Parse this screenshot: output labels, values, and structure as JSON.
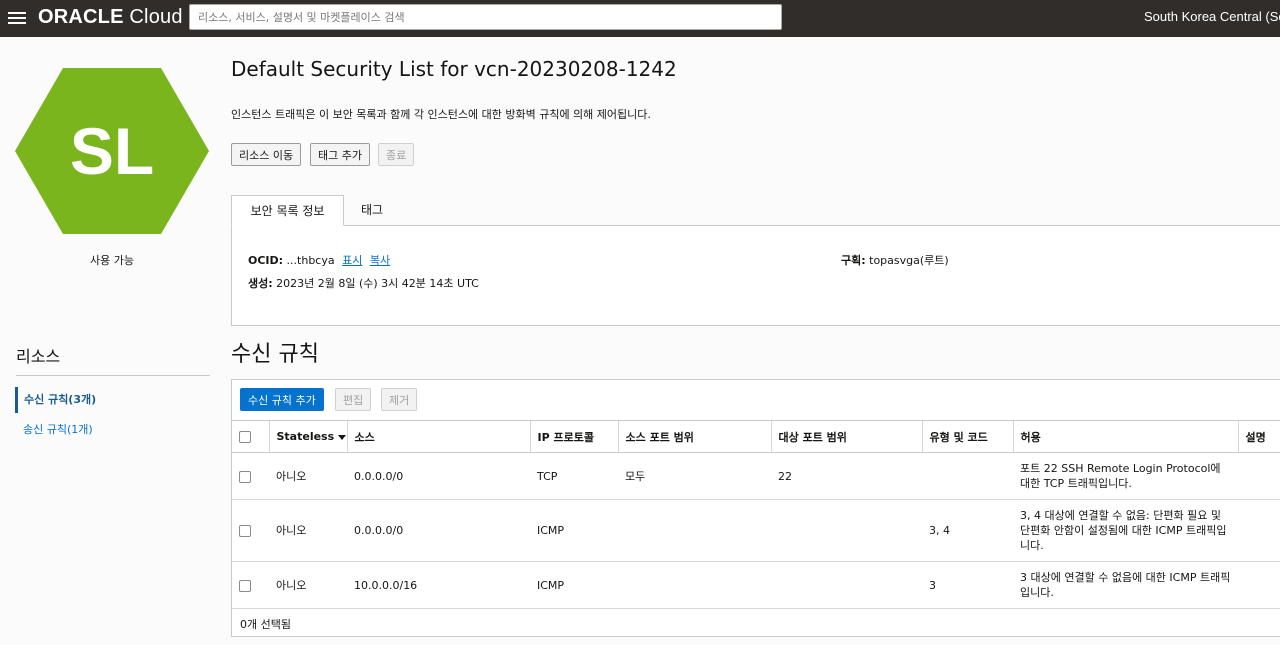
{
  "topbar": {
    "brand_bold": "ORACLE",
    "brand_light": " Cloud",
    "search_placeholder": "리소스, 서비스, 설명서 및 마켓플레이스 검색",
    "region": "South Korea Central (Seoul)"
  },
  "resource": {
    "badge_text": "SL",
    "badge_color": "#7ab51d",
    "status": "사용 가능"
  },
  "header": {
    "title": "Default Security List for vcn-20230208-1242",
    "description": "인스턴스 트래픽은 이 보안 목록과 함께 각 인스턴스에 대한 방화벽 규칙에 의해 제어됩니다.",
    "buttons": {
      "move": "리소스 이동",
      "add_tag": "태그 추가",
      "terminate": "종료"
    }
  },
  "tabs": {
    "info": "보안 목록 정보",
    "tags": "태그"
  },
  "info": {
    "ocid_label": "OCID:",
    "ocid_value": "...thbcya",
    "show_link": "표시",
    "copy_link": "복사",
    "created_label": "생성:",
    "created_value": "2023년 2월 8일 (수) 3시 42분 14초 UTC",
    "compartment_label": "구획:",
    "compartment_value": "topasvga(루트)"
  },
  "sidebar": {
    "title": "리소스",
    "items": [
      {
        "label": "수신 규칙(3개)"
      },
      {
        "label": "송신 규칙(1개)"
      }
    ]
  },
  "ingress": {
    "section_title": "수신 규칙",
    "buttons": {
      "add": "수신 규칙 추가",
      "edit": "편집",
      "remove": "제거"
    },
    "columns": [
      "Stateless",
      "소스",
      "IP 프로토콜",
      "소스 포트 범위",
      "대상 포트 범위",
      "유형 및 코드",
      "허용",
      "설명"
    ],
    "rows": [
      {
        "stateless": "아니오",
        "source": "0.0.0.0/0",
        "protocol": "TCP",
        "src_port": "모두",
        "dst_port": "22",
        "type_code": "",
        "allows": "포트 22 SSH Remote Login Protocol에 대한 TCP 트래픽입니다.",
        "desc": ""
      },
      {
        "stateless": "아니오",
        "source": "0.0.0.0/0",
        "protocol": "ICMP",
        "src_port": "",
        "dst_port": "",
        "type_code": "3, 4",
        "allows": "3, 4 대상에 연결할 수 없음: 단편화 필요 및 단편화 안함이 설정됨에 대한 ICMP 트래픽입니다.",
        "desc": ""
      },
      {
        "stateless": "아니오",
        "source": "10.0.0.0/16",
        "protocol": "ICMP",
        "src_port": "",
        "dst_port": "",
        "type_code": "3",
        "allows": "3 대상에 연결할 수 없음에 대한 ICMP 트래픽입니다.",
        "desc": ""
      }
    ],
    "footer": "0개 선택됨"
  }
}
